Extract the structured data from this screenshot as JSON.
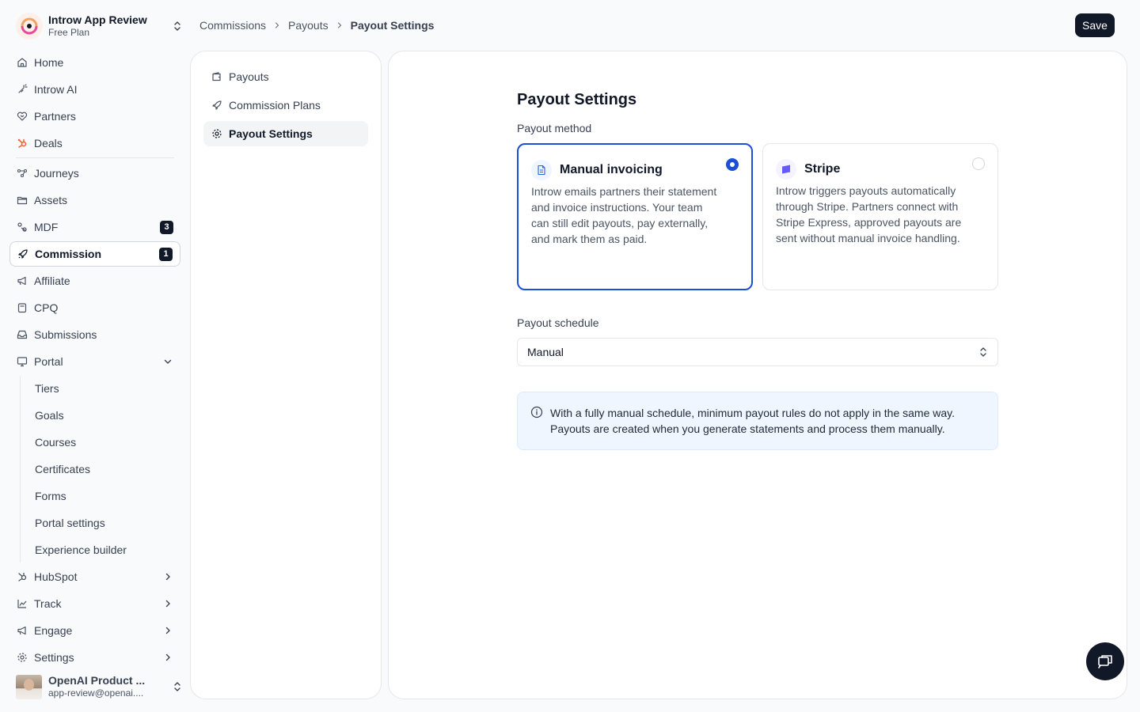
{
  "org": {
    "name": "Introw App Review",
    "plan": "Free Plan"
  },
  "sidebar": {
    "items": [
      {
        "label": "Home",
        "icon": "home-icon"
      },
      {
        "label": "Introw AI",
        "icon": "sparkles-icon"
      },
      {
        "label": "Partners",
        "icon": "handshake-icon"
      },
      {
        "label": "Deals",
        "icon": "hubspot-icon"
      },
      {
        "label": "Journeys",
        "icon": "journeys-icon"
      },
      {
        "label": "Assets",
        "icon": "folder-icon"
      },
      {
        "label": "MDF",
        "icon": "percent-icon",
        "badge": "3"
      },
      {
        "label": "Commission",
        "icon": "rocket-icon",
        "badge": "1"
      },
      {
        "label": "Affiliate",
        "icon": "megaphone-icon"
      },
      {
        "label": "CPQ",
        "icon": "calculator-icon"
      },
      {
        "label": "Submissions",
        "icon": "inbox-icon"
      },
      {
        "label": "Portal",
        "icon": "monitor-icon"
      },
      {
        "label": "HubSpot",
        "icon": "hubspot-icon"
      },
      {
        "label": "Track",
        "icon": "chart-icon"
      },
      {
        "label": "Engage",
        "icon": "megaphone-icon"
      },
      {
        "label": "Settings",
        "icon": "gear-icon"
      }
    ],
    "portal_sub": [
      "Tiers",
      "Goals",
      "Courses",
      "Certificates",
      "Forms",
      "Portal settings",
      "Experience builder"
    ]
  },
  "user": {
    "name": "OpenAI Product ...",
    "email": "app-review@openai...."
  },
  "breadcrumb": [
    "Commissions",
    "Payouts",
    "Payout Settings"
  ],
  "toolbar": {
    "save_label": "Save"
  },
  "subnav": [
    "Payouts",
    "Commission Plans",
    "Payout Settings"
  ],
  "main": {
    "title": "Payout Settings",
    "method_label": "Payout method",
    "methods": [
      {
        "title": "Manual invoicing",
        "desc": "Introw emails partners their statement and invoice instructions. Your team can still edit payouts, pay externally, and mark them as paid.",
        "selected": true
      },
      {
        "title": "Stripe",
        "desc": "Introw triggers payouts automatically through Stripe. Partners connect with Stripe Express, approved payouts are sent without manual invoice handling.",
        "selected": false
      }
    ],
    "schedule_label": "Payout schedule",
    "schedule_value": "Manual",
    "info_text": "With a fully manual schedule, minimum payout rules do not apply in the same way. Payouts are created when you generate statements and process them manually."
  },
  "colors": {
    "accent": "#1d4ed8",
    "dark": "#111827",
    "info_bg": "#eff6ff"
  }
}
